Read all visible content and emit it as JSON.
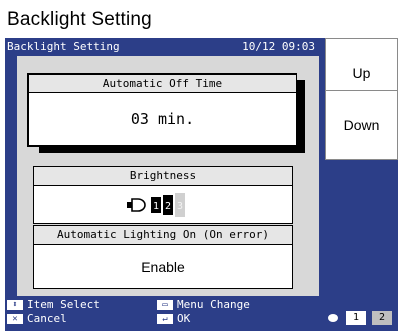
{
  "caption": "Backlight Setting",
  "header": {
    "title": "Backlight Setting",
    "datetime": "10/12 09:03"
  },
  "side_buttons": {
    "up": "Up",
    "down": "Down"
  },
  "auto_off": {
    "label": "Automatic Off Time",
    "value": "03 min."
  },
  "brightness": {
    "label": "Brightness",
    "levels": [
      "1",
      "2",
      "3"
    ],
    "current_level": 2,
    "icon": "bulb-icon"
  },
  "auto_light": {
    "label": "Automatic Lighting On (On error)",
    "value": "Enable"
  },
  "footer": {
    "item_select": "Item Select",
    "cancel": "Cancel",
    "menu_change": "Menu Change",
    "ok": "OK"
  },
  "pager": {
    "page1": "1",
    "page2": "2"
  },
  "colors": {
    "screen_bg": "#2c3e88",
    "panel_bg": "#d8d8d8"
  }
}
